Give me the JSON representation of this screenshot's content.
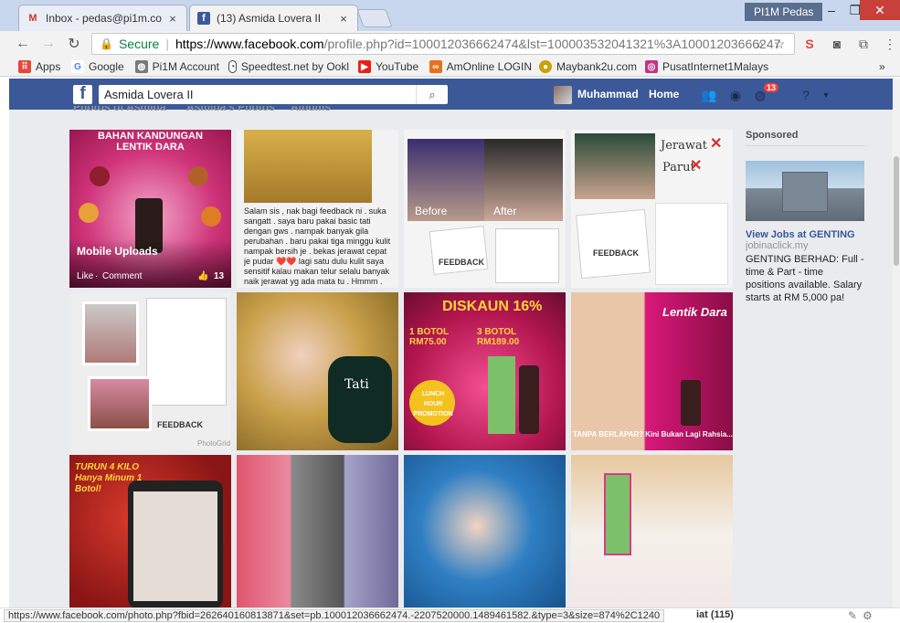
{
  "browser": {
    "tabs": [
      {
        "title": "Inbox - pedas@pi1m.co",
        "close": "×"
      },
      {
        "title": "(13) Asmida Lovera II",
        "close": "×"
      }
    ],
    "profile": "PI1M Pedas",
    "window": {
      "minimize": "–",
      "restore": "❐",
      "close": "✕"
    },
    "secure_label": "Secure",
    "url_host": "https://www.facebook.com",
    "url_rest": "/profile.php?id=100012036662474&lst=100003532041321%3A10001203666247",
    "bookmarks": [
      {
        "label": "Apps",
        "icon": "apps-grid-icon",
        "color": "#e8453c"
      },
      {
        "label": "Google",
        "icon": "google-icon",
        "color": "#4285f4"
      },
      {
        "label": "Pi1M Account",
        "icon": "globe-icon",
        "color": "#7a7a7a"
      },
      {
        "label": "Speedtest.net by Ookl",
        "icon": "gauge-icon",
        "color": "#444444"
      },
      {
        "label": "YouTube",
        "icon": "youtube-icon",
        "color": "#e62117"
      },
      {
        "label": "AmOnline LOGIN",
        "icon": "amonline-icon",
        "color": "#e8711c"
      },
      {
        "label": "Maybank2u.com",
        "icon": "maybank-icon",
        "color": "#c9a100"
      },
      {
        "label": "PusatInternet1Malays",
        "icon": "instagram-icon",
        "color": "#c13584"
      }
    ],
    "more_bookmarks": "»"
  },
  "facebook": {
    "search_value": "Asmida Lovera II",
    "user": "Muhammad",
    "home": "Home",
    "notification_count": "13",
    "subtabs": [
      "Photos of Asmida",
      "Asmida's Photos",
      "Albums"
    ]
  },
  "photos": [
    {
      "title_top": "BAHAN KANDUNGAN",
      "title_bottom": "LENTIK DARA",
      "overlay": "Mobile Uploads",
      "like": "Like",
      "comment": "Comment",
      "count": "13"
    },
    {
      "caption": "Salam sis , nak bagi feedback ni . suka sangatt . saya baru pakai basic tati dengan gws . nampak banyak gila perubahan . baru pakai tiga minggu kulit nampak bersih je . bekas jerawat cepat je pudar ❤️❤️ lagi satu dulu kulit saya sensitif kalau makan telur selalu banyak naik jerawat yg ada mata tu . Hmmm ."
    },
    {
      "label_a": "Before",
      "label_b": "After",
      "tag": "FEEDBACK"
    },
    {
      "label_a": "Jerawat",
      "label_b": "Parut",
      "tag": "FEEDBACK"
    },
    {
      "tag": "FEEDBACK",
      "watermark": "PhotoGrid"
    },
    {
      "product": "Tati"
    },
    {
      "headline": "DISKAUN 16%",
      "price_a": "1 BOTOL RM75.00",
      "price_b": "3 BOTOL RM189.00",
      "promo": "LUNCH HOUR PROMOTION"
    },
    {
      "headline": "Lentik Dara",
      "footer": "TANPA BERLAPAR? Kini Bukan Lagi Rahsia..."
    },
    {
      "headline": "TURUN 4 KILO Hanya Minum 1 Botol!"
    },
    {},
    {},
    {}
  ],
  "sidebar": {
    "sponsored": "Sponsored",
    "ad_title": "View Jobs at GENTING",
    "ad_link": "jobinaclick.my",
    "ad_body": "GENTING BERHAD: Full - time & Part - time positions available. Salary starts at RM 5,000 pa!"
  },
  "status": {
    "url": "https://www.facebook.com/photo.php?fbid=262640160813871&set=pb.100012036662474.-2207520000.1489461582.&type=3&size=874%2C1240",
    "right_text": "iat (115)"
  }
}
